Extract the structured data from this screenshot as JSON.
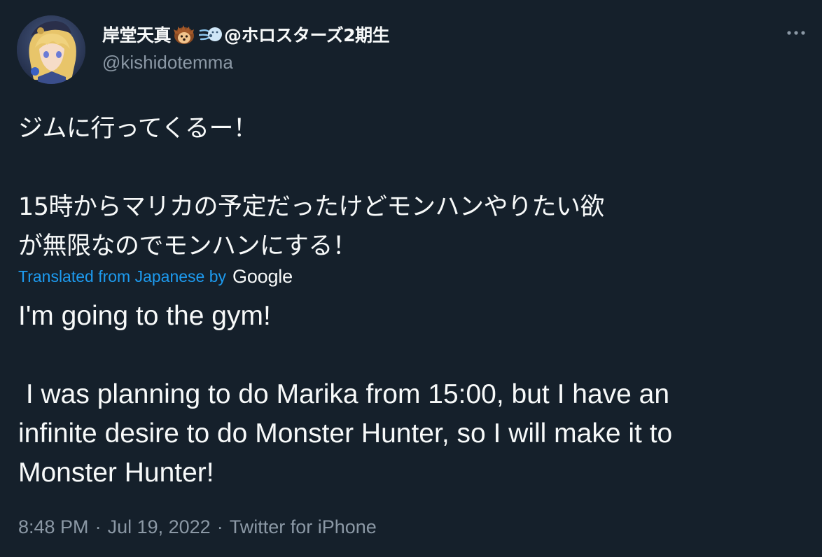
{
  "tweet": {
    "display_name": "岸堂天真",
    "name_suffix": "@ホロスターズ2期生",
    "handle": "@kishidotemma",
    "emojis": [
      "hedgehog-emoji",
      "wind-blowing-face-emoji"
    ],
    "more_icon": "more-options-icon",
    "text_japanese": "ジムに行ってくるー！\n\n15時からマリカの予定だったけどモンハンやりたい欲\nが無限なのでモンハンにする！",
    "translated_label": "Translated from Japanese by",
    "translator_name": "Google",
    "text_english": "I'm going to the gym!\n\n I was planning to do Marika from 15:00, but I have an\ninfinite desire to do Monster Hunter, so I will make it to\nMonster Hunter!",
    "time": "8:48 PM",
    "date": "Jul 19, 2022",
    "separator": "·",
    "source": "Twitter for iPhone"
  },
  "colors": {
    "background": "#15202b",
    "text_primary": "#f7f9f9",
    "text_secondary": "#8b98a5",
    "link": "#1d9bf0"
  }
}
